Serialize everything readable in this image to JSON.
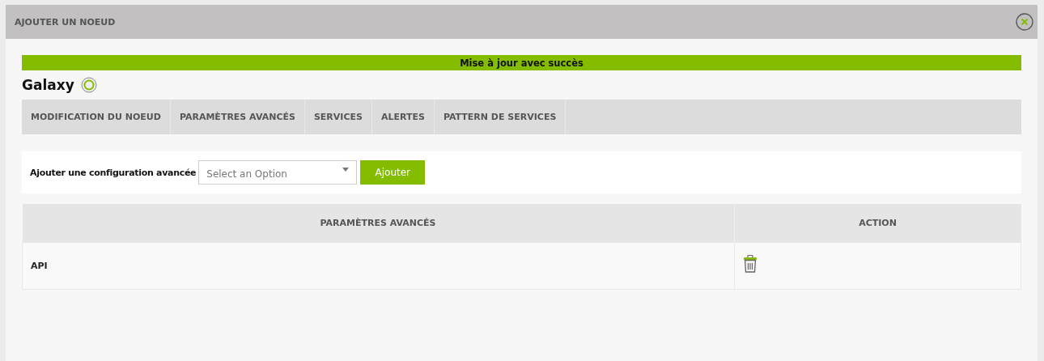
{
  "window": {
    "title": "AJOUTER UN NOEUD"
  },
  "alert": {
    "message": "Mise à jour avec succès"
  },
  "node": {
    "name": "Galaxy"
  },
  "tabs": [
    {
      "label": "MODIFICATION DU NOEUD",
      "selected": false
    },
    {
      "label": "PARAMÈTRES AVANCÉS",
      "selected": false
    },
    {
      "label": "SERVICES",
      "selected": false
    },
    {
      "label": "ALERTES",
      "selected": false
    },
    {
      "label": "PATTERN DE SERVICES",
      "selected": false
    }
  ],
  "add_config": {
    "label": "Ajouter une configuration avancée",
    "placeholder": "Select an Option",
    "button": "Ajouter"
  },
  "table": {
    "columns": [
      "PARAMÈTRES AVANCÉS",
      "ACTION"
    ],
    "rows": [
      {
        "name": "API"
      }
    ]
  }
}
